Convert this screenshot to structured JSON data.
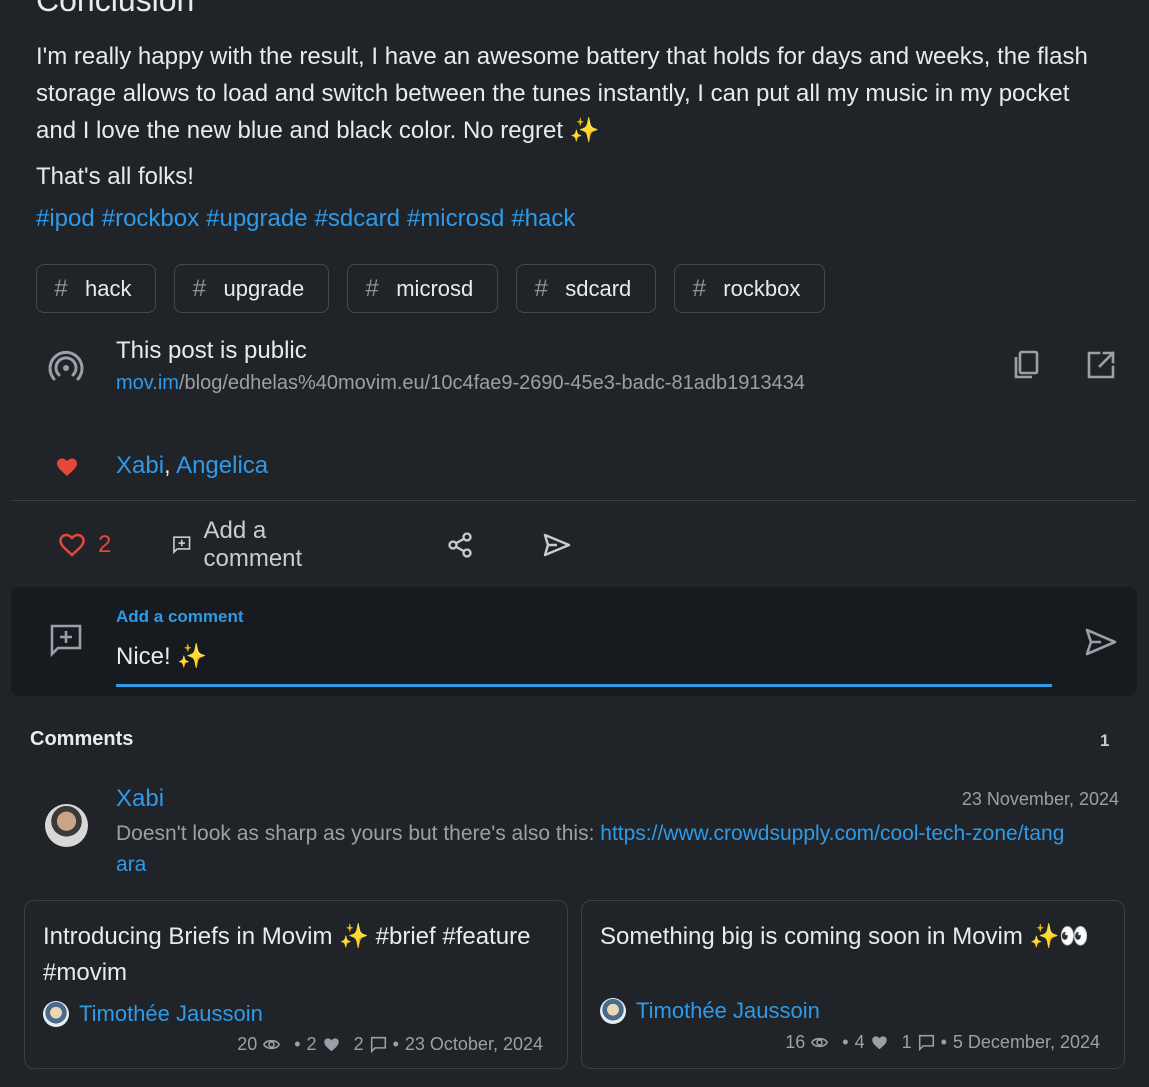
{
  "post": {
    "heading": "Conclusion",
    "paragraph1": "I'm really happy with the result, I have an awesome battery that holds for days and weeks, the flash storage allows to load and switch between the tunes instantly, I can put all my music in my pocket and I love the new blue and black color. No regret ✨",
    "paragraph2": "That's all folks!",
    "hashtags": [
      "#ipod",
      "#rockbox",
      "#upgrade",
      "#sdcard",
      "#microsd",
      "#hack"
    ],
    "tags": [
      "hack",
      "upgrade",
      "microsd",
      "sdcard",
      "rockbox"
    ]
  },
  "visibility": {
    "title": "This post is public",
    "url_domain": "mov.im",
    "url_path": "/blog/edhelas%40movim.eu/10c4fae9-2690-45e3-badc-81adb1913434",
    "copy_icon": "copy-icon",
    "open_icon": "open-external-icon"
  },
  "likers": {
    "names": [
      "Xabi",
      "Angelica"
    ],
    "separator": ","
  },
  "actions": {
    "like_count": "2",
    "comment_label": "Add a comment"
  },
  "comment_form": {
    "label": "Add a comment",
    "value": "Nice! ✨"
  },
  "comments": {
    "title": "Comments",
    "count": "1",
    "items": [
      {
        "author": "Xabi",
        "date": "23 November, 2024",
        "text": "Doesn't look as sharp as yours but there's also this: ",
        "link": "https://www.crowdsupply.com/cool-tech-zone/tangara"
      }
    ]
  },
  "related": [
    {
      "title": "Introducing Briefs in Movim ✨ #brief #feature #movim",
      "author": "Timothée Jaussoin",
      "views": "20",
      "likes": "2",
      "comments": "2",
      "date": "23 October, 2024"
    },
    {
      "title": "Something big is coming soon in Movim ✨👀",
      "author": "Timothée Jaussoin",
      "views": "16",
      "likes": "4",
      "comments": "1",
      "date": "5 December, 2024"
    }
  ],
  "colors": {
    "background": "#202429",
    "accent": "#2f9ae8",
    "like": "#e8453c",
    "muted": "#9aa0a6"
  }
}
